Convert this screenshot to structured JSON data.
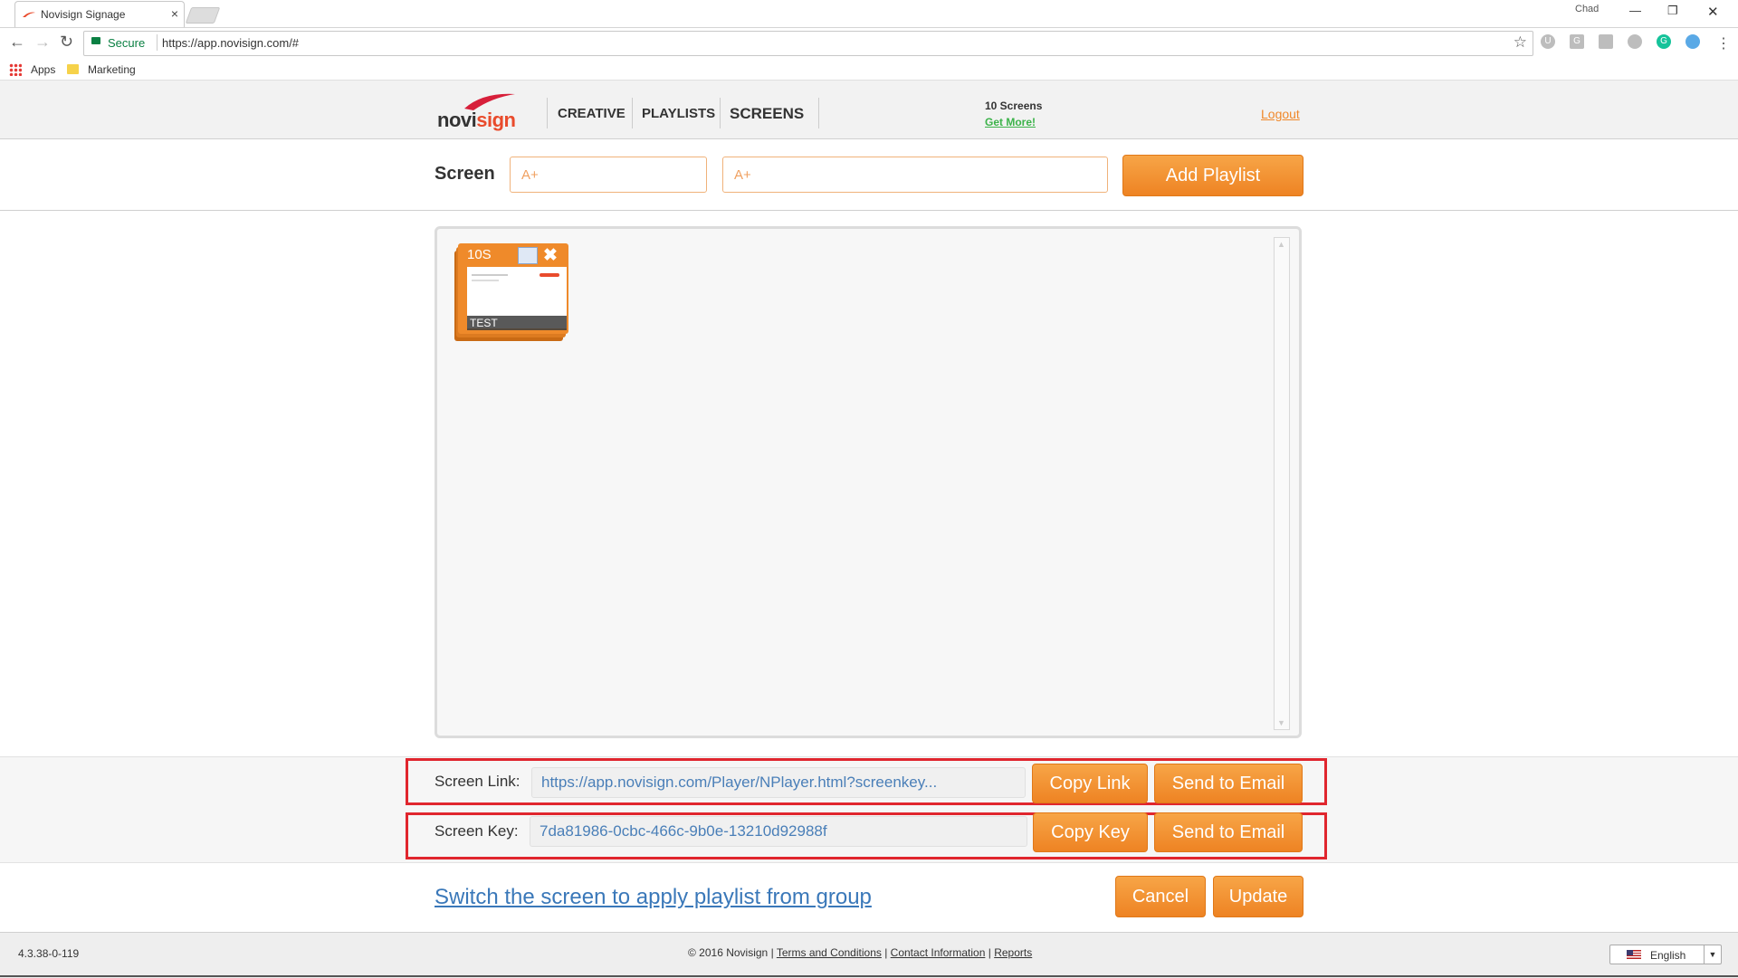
{
  "browser": {
    "tab_title": "Novisign Signage",
    "tab_close": "×",
    "user_badge": "Chad",
    "secure_label": "Secure",
    "url": "https://app.novisign.com/#",
    "bookmarks": [
      {
        "label": "Apps"
      },
      {
        "label": "Marketing"
      }
    ]
  },
  "header": {
    "logo_text_a": "novi",
    "logo_text_b": "sign",
    "nav": [
      {
        "label": "CREATIVE"
      },
      {
        "label": "PLAYLISTS"
      },
      {
        "label": "SCREENS"
      }
    ],
    "screens_count": "10 Screens",
    "get_more": "Get More!",
    "logout": "Logout"
  },
  "screen_form": {
    "label": "Screen",
    "name_placeholder": "A+",
    "desc_placeholder": "A+",
    "add_playlist": "Add Playlist"
  },
  "playlist_items": [
    {
      "duration": "10S",
      "name": "TEST"
    }
  ],
  "screen_link": {
    "label": "Screen Link:",
    "value": "https://app.novisign.com/Player/NPlayer.html?screenkey...",
    "copy_label": "Copy Link",
    "send_label": "Send to Email"
  },
  "screen_key": {
    "label": "Screen Key:",
    "value": "7da81986-0cbc-466c-9b0e-13210d92988f",
    "copy_label": "Copy Key",
    "send_label": "Send to Email"
  },
  "actions": {
    "switch_link": "Switch the screen to apply playlist from group",
    "cancel": "Cancel",
    "update": "Update"
  },
  "footer": {
    "version": "4.3.38-0-119",
    "copyright": "© 2016 Novisign",
    "links": [
      "Terms and Conditions",
      "Contact Information",
      "Reports"
    ],
    "language": "English"
  },
  "colors": {
    "accent": "#ee8323",
    "highlight_border": "#e0262e",
    "link": "#3a78b9",
    "get_more": "#3cb34a"
  }
}
